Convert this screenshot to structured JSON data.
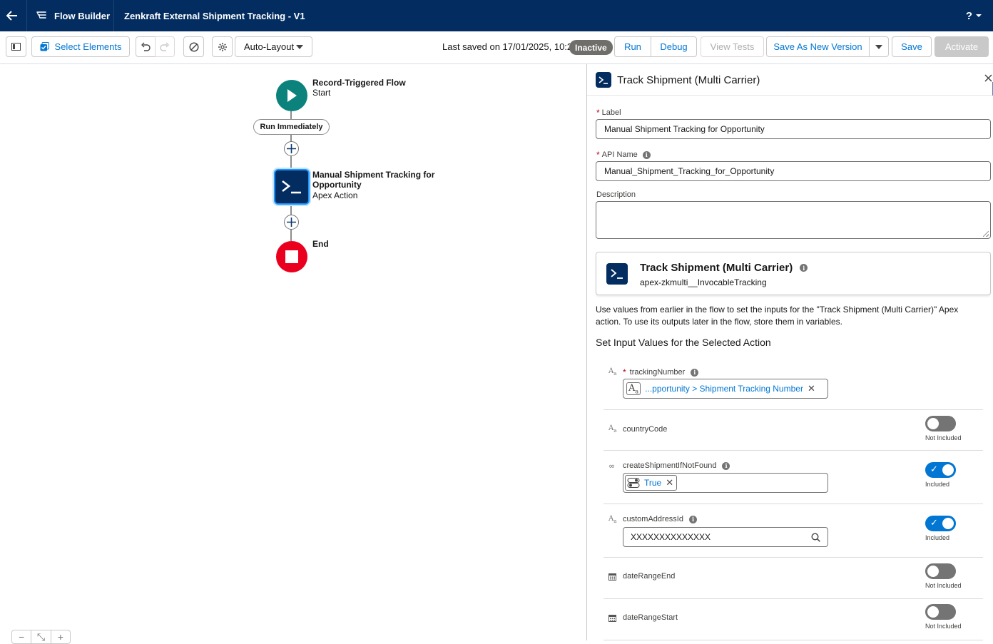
{
  "header": {
    "app_name": "Flow Builder",
    "flow_name": "Zenkraft External Shipment Tracking - V1",
    "help_label": "?"
  },
  "toolbar": {
    "select_elements": "Select Elements",
    "layout_mode": "Auto-Layout",
    "last_saved": "Last saved on 17/01/2025, 10:26",
    "status": "Inactive",
    "run": "Run",
    "debug": "Debug",
    "view_tests": "View Tests",
    "save_as_new_version": "Save As New Version",
    "save": "Save",
    "activate": "Activate"
  },
  "canvas": {
    "start": {
      "title": "Record-Triggered Flow",
      "subtitle": "Start"
    },
    "path_label": "Run Immediately",
    "action": {
      "title_line1": "Manual Shipment Tracking for",
      "title_line2": "Opportunity",
      "subtitle": "Apex Action"
    },
    "end": {
      "title": "End"
    },
    "zoom": {
      "out": "−",
      "fit": "⤡",
      "in": "+"
    }
  },
  "panel": {
    "title": "Track Shipment (Multi Carrier)",
    "label_field": {
      "label": "Label",
      "value": "Manual Shipment Tracking for Opportunity"
    },
    "api_field": {
      "label": "API Name",
      "value": "Manual_Shipment_Tracking_for_Opportunity"
    },
    "description_field": {
      "label": "Description",
      "value": ""
    },
    "action_card": {
      "title": "Track Shipment (Multi Carrier)",
      "subtitle": "apex-zkmulti__InvocableTracking"
    },
    "help_text": "Use values from earlier in the flow to set the inputs for the \"Track Shipment (Multi Carrier)\" Apex action. To use its outputs later in the flow, store them in variables.",
    "section_title": "Set Input Values for the Selected Action",
    "params": [
      {
        "name": "trackingNumber",
        "value": "...pportunity > Shipment Tracking Number"
      },
      {
        "name": "countryCode",
        "toggle_label": "Not Included"
      },
      {
        "name": "createShipmentIfNotFound",
        "value": "True",
        "toggle_label": "Included"
      },
      {
        "name": "customAddressId",
        "value": "XXXXXXXXXXXXXX",
        "toggle_label": "Included"
      },
      {
        "name": "dateRangeEnd",
        "toggle_label": "Not Included"
      },
      {
        "name": "dateRangeStart",
        "toggle_label": "Not Included"
      }
    ]
  }
}
